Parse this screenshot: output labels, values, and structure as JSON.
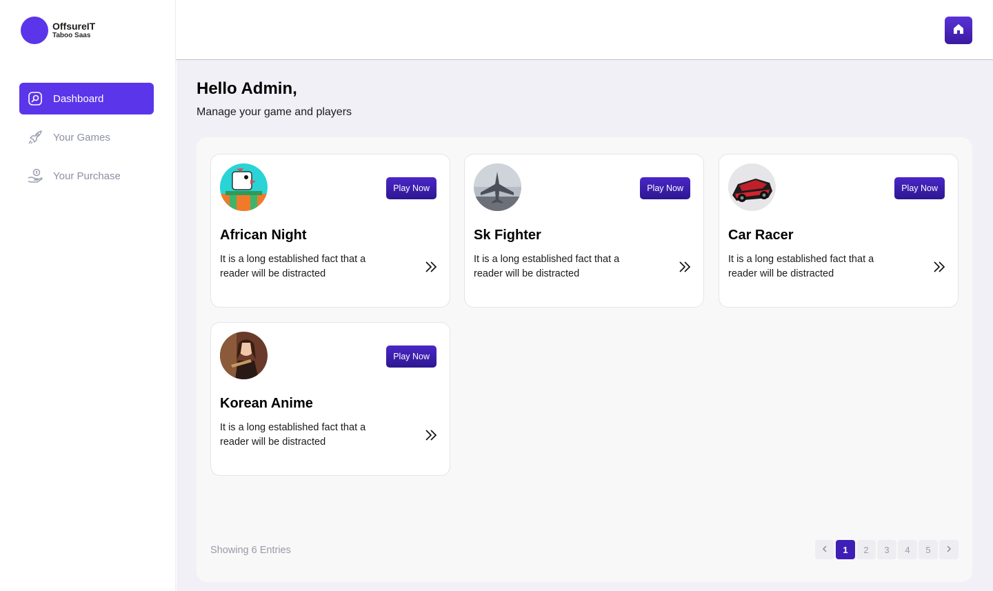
{
  "brand": {
    "name": "OffsureIT",
    "subtitle": "Taboo Saas",
    "logo_color": "#5b35ea"
  },
  "sidebar": {
    "items": [
      {
        "label": "Dashboard",
        "icon": "dashboard-icon",
        "active": true
      },
      {
        "label": "Your Games",
        "icon": "rocket-icon",
        "active": false
      },
      {
        "label": "Your Purchase",
        "icon": "hand-coin-icon",
        "active": false
      }
    ]
  },
  "topbar": {
    "home_icon": "home-icon"
  },
  "main": {
    "greeting": "Hello Admin,",
    "subtitle": "Manage your game and players"
  },
  "games": [
    {
      "title": "African Night",
      "description": "It is a long established fact that a reader will be distracted",
      "button": "Play Now",
      "thumbnail": "bird-game-thumbnail"
    },
    {
      "title": "Sk Fighter",
      "description": "It is a long established fact that a reader will be distracted",
      "button": "Play Now",
      "thumbnail": "fighter-jet-thumbnail"
    },
    {
      "title": "Car Racer",
      "description": "It is a long established fact that a reader will be distracted",
      "button": "Play Now",
      "thumbnail": "race-car-thumbnail"
    },
    {
      "title": "Korean Anime",
      "description": "It is a long established fact that a reader will be distracted",
      "button": "Play Now",
      "thumbnail": "anime-girl-thumbnail"
    }
  ],
  "footer": {
    "entries_text": "Showing 6 Entries",
    "pages": [
      "1",
      "2",
      "3",
      "4",
      "5"
    ],
    "current_page": "1"
  },
  "colors": {
    "accent": "#5b35ea",
    "button": "#3e1fb6",
    "background": "#f2f0f7"
  }
}
